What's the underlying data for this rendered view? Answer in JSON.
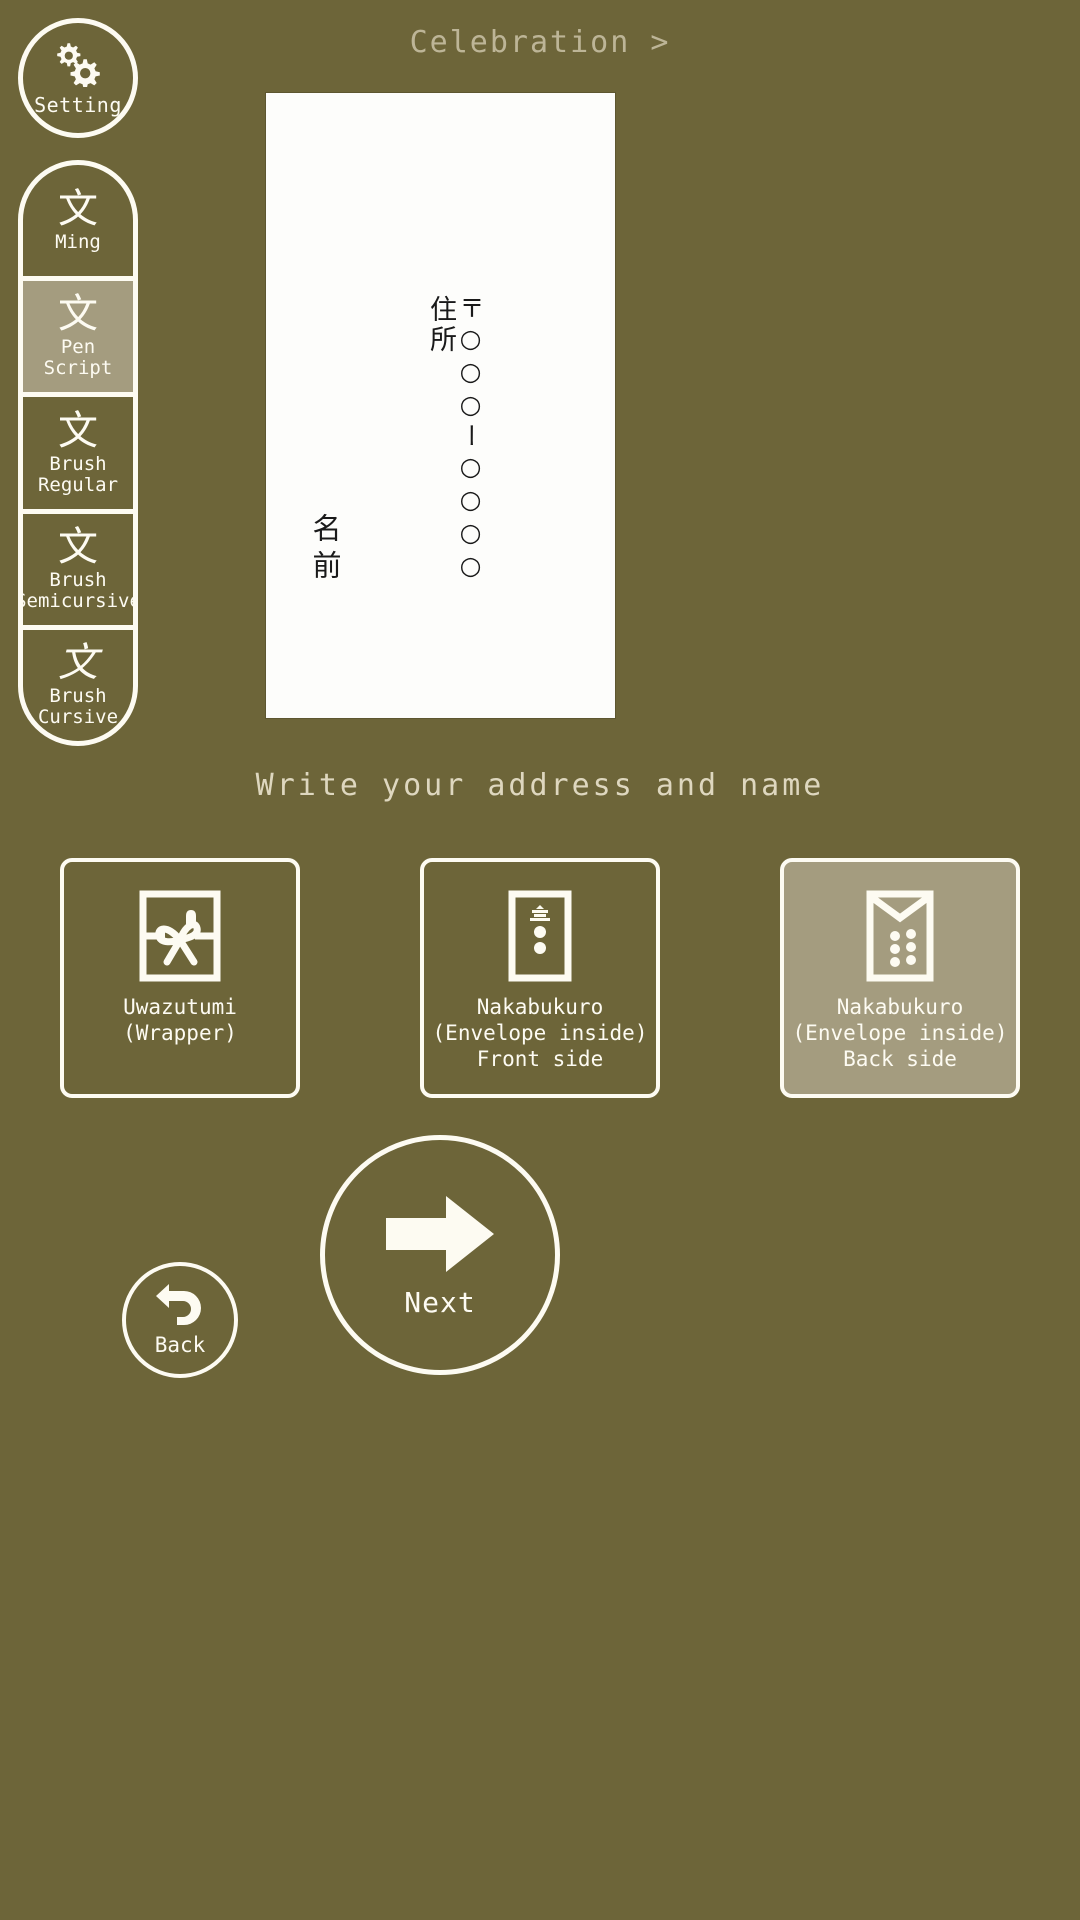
{
  "theme": {
    "background": "#6d6539",
    "foreground": "#fdfbf2",
    "selected_fill": "#a49c7f",
    "caption_color": "#ded7bf",
    "header_color": "#bdb597",
    "paper": "#fdfdfb",
    "ink": "#1a1a1a"
  },
  "header": {
    "title": "Celebration >"
  },
  "setting": {
    "label": "Setting",
    "icon": "gears-icon"
  },
  "font_rail": {
    "items": [
      {
        "glyph": "文",
        "label": "Ming",
        "selected": false,
        "style": "serif"
      },
      {
        "glyph": "文",
        "label": "Pen\nScript",
        "selected": true,
        "style": "thin"
      },
      {
        "glyph": "文",
        "label": "Brush\nRegular",
        "selected": false,
        "style": "brush"
      },
      {
        "glyph": "文",
        "label": "Brush\nSemicursive",
        "selected": false,
        "style": "brush"
      },
      {
        "glyph": "文",
        "label": "Brush\nCursive",
        "selected": false,
        "style": "cursive"
      }
    ]
  },
  "envelope_preview": {
    "postal_code": "〒○○○ー○○○○",
    "address_label": "住所",
    "name_label": "名前"
  },
  "caption": {
    "text": "Write your address and name"
  },
  "type_cards": [
    {
      "label": "Uwazutumi\n(Wrapper)",
      "icon": "wrapper-mizuhiki-icon",
      "selected": false
    },
    {
      "label": "Nakabukuro\n(Envelope inside)\nFront side",
      "icon": "envelope-front-icon",
      "selected": false
    },
    {
      "label": "Nakabukuro\n(Envelope inside)\nBack side",
      "icon": "envelope-back-icon",
      "selected": true
    }
  ],
  "nav": {
    "next_label": "Next",
    "back_label": "Back"
  }
}
